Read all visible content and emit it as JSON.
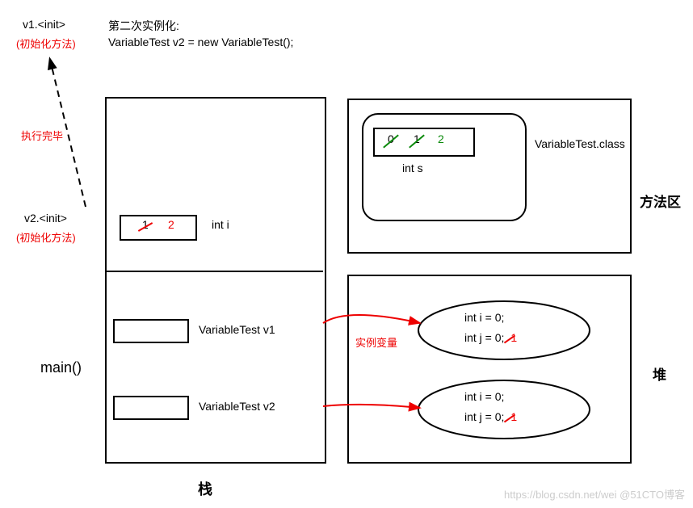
{
  "header": {
    "v1_init": "v1.<init>",
    "v1_init_note": "(初始化方法)",
    "title": "第二次实例化:",
    "code": "VariableTest v2 = new VariableTest();"
  },
  "arrow_labels": {
    "exec_done": "执行完毕",
    "v2_init": "v2.<init>",
    "v2_init_note": "(初始化方法)",
    "instance_var": "实例变量"
  },
  "stack": {
    "int_i_label": "int i",
    "i_values": {
      "old": "1",
      "new": "2"
    },
    "ref1": "VariableTest  v1",
    "ref2": "VariableTest  v2",
    "main": "main()",
    "caption": "栈"
  },
  "method_area": {
    "class_name": "VariableTest.class",
    "int_s": "int s",
    "s_values": {
      "v0": "0",
      "v1": "1",
      "v2": "2"
    },
    "caption": "方法区"
  },
  "heap": {
    "obj1": {
      "line1": "int i = 0;",
      "line2_prefix": "int j = ",
      "line2_old": "0",
      "line2_suffix": ";",
      "line2_new": "1"
    },
    "obj2": {
      "line1": "int i = 0;",
      "line2_prefix": "int j = ",
      "line2_old": "0",
      "line2_suffix": ";",
      "line2_new": "1"
    },
    "caption": "堆"
  },
  "watermark": "https://blog.csdn.net/wei @51CTO博客"
}
